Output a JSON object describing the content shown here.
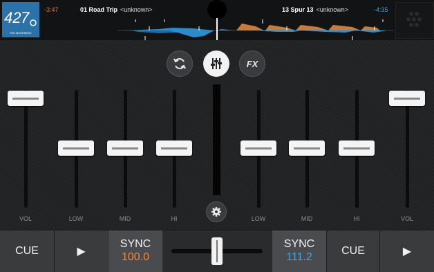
{
  "deck_left": {
    "time_remaining": "-3:47",
    "track_title": "01 Road Trip",
    "artist": "<unknown>",
    "cover_text": "42 70",
    "cover_subtext": "THE MOVEMENT"
  },
  "deck_right": {
    "time_remaining": "-4:35",
    "track_title": "13 Spur 13",
    "artist": "<unknown>"
  },
  "center_buttons": {
    "fx_label": "FX"
  },
  "sliders": {
    "left_volume": {
      "label": "VOL",
      "level": 1.0
    },
    "left_low": {
      "label": "LOW",
      "level": 0.5
    },
    "left_mid": {
      "label": "MID",
      "level": 0.5
    },
    "left_hi": {
      "label": "HI",
      "level": 0.5
    },
    "right_low": {
      "label": "LOW",
      "level": 0.5
    },
    "right_mid": {
      "label": "MID",
      "level": 0.5
    },
    "right_hi": {
      "label": "HI",
      "level": 0.5
    },
    "right_volume": {
      "label": "VOL",
      "level": 1.0
    }
  },
  "bottom": {
    "left_cue": "CUE",
    "left_play": "▶",
    "left_sync_label": "SYNC",
    "left_bpm": "100.0",
    "right_sync_label": "SYNC",
    "right_bpm": "111.2",
    "right_cue": "CUE",
    "right_play": "▶",
    "crossfader_position": 0.5
  },
  "colors": {
    "left_accent": "#e0783a",
    "right_accent": "#3aa6e8",
    "left_bpm_color": "#f08a3c",
    "right_bpm_color": "#3aa6e8"
  }
}
